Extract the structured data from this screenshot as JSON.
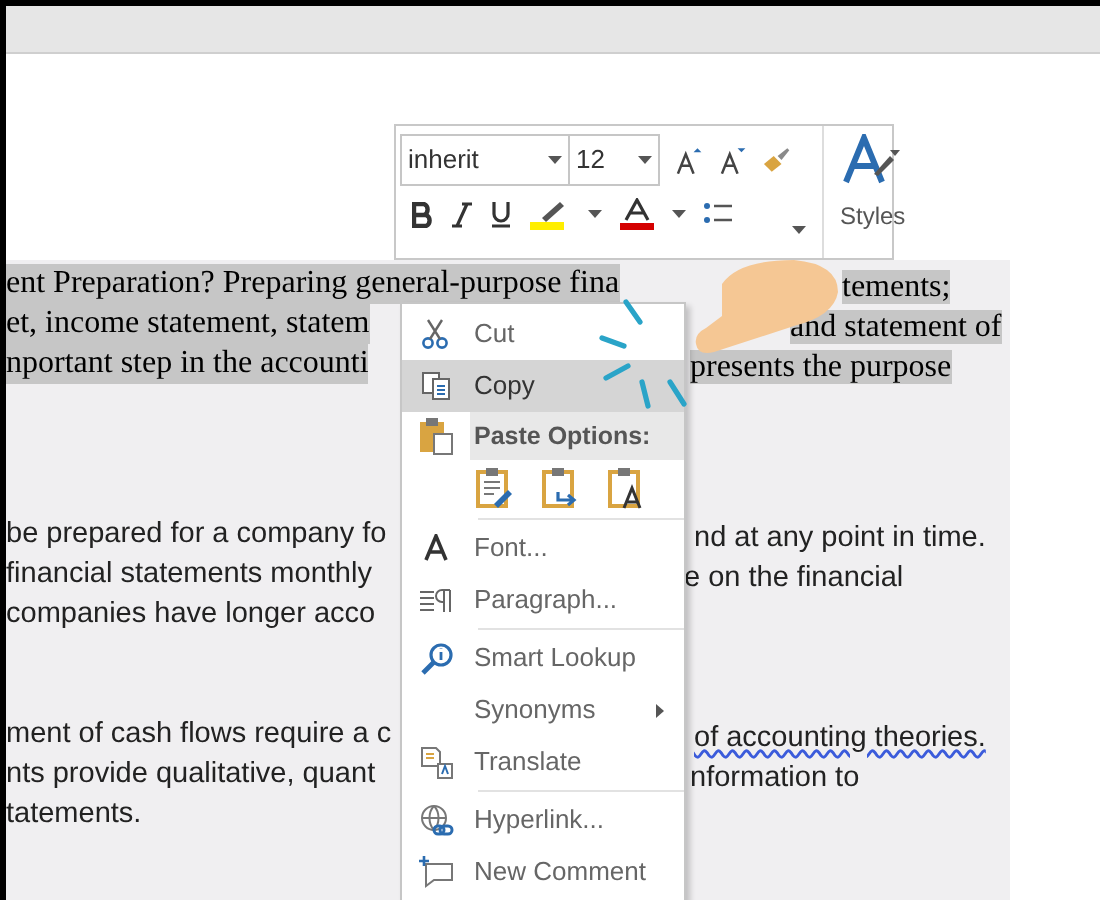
{
  "mini_toolbar": {
    "font_name": "inherit",
    "font_size": "12",
    "styles_label": "Styles"
  },
  "document": {
    "lines": [
      {
        "kind": "serif",
        "selected": true,
        "left": "ent Preparation? Preparing general-purpose fina",
        "right": "tements;"
      },
      {
        "kind": "serif",
        "selected": true,
        "left": "et, income statement, statem",
        "right": "and statement of"
      },
      {
        "kind": "serif",
        "selected": true,
        "left": "nportant step in the accounti",
        "right": "presents the purpose"
      },
      {
        "kind": "gap"
      },
      {
        "kind": "sans",
        "selected": false,
        "left": "be prepared for a company fo",
        "right": "nd at any point in time."
      },
      {
        "kind": "sans",
        "selected": false,
        "left": "financial statements monthly",
        "right": "e on the financial"
      },
      {
        "kind": "sans",
        "selected": false,
        "left": "companies have longer acco"
      },
      {
        "kind": "gap"
      },
      {
        "kind": "sans",
        "selected": false,
        "left": "ment of cash flows require a c",
        "right": "of accounting theories.",
        "misspelled": true
      },
      {
        "kind": "sans",
        "selected": false,
        "left": "nts provide qualitative, quant",
        "right": "nformation to"
      },
      {
        "kind": "sans",
        "selected": false,
        "left": "tatements."
      }
    ]
  },
  "context_menu": {
    "items": [
      {
        "kind": "item",
        "label": "Cut",
        "selected": false
      },
      {
        "kind": "item",
        "label": "Copy",
        "selected": true
      },
      {
        "kind": "header",
        "label": "Paste Options:"
      },
      {
        "kind": "paste-row"
      },
      {
        "kind": "separator"
      },
      {
        "kind": "item",
        "label": "Font...",
        "selected": false
      },
      {
        "kind": "item",
        "label": "Paragraph...",
        "selected": false
      },
      {
        "kind": "separator"
      },
      {
        "kind": "item",
        "label": "Smart Lookup",
        "selected": false
      },
      {
        "kind": "submenu",
        "label": "Synonyms",
        "selected": false
      },
      {
        "kind": "item",
        "label": "Translate",
        "selected": false
      },
      {
        "kind": "separator"
      },
      {
        "kind": "item",
        "label": "Hyperlink...",
        "selected": false
      },
      {
        "kind": "item",
        "label": "New Comment",
        "selected": false
      }
    ]
  }
}
